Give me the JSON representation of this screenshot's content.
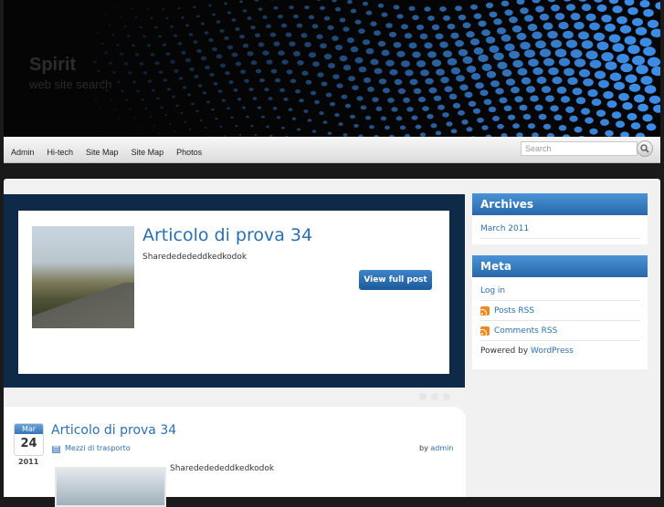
{
  "header": {
    "title": "Spirit",
    "tagline": "web site search"
  },
  "nav": {
    "items": [
      "Admin",
      "Hi-tech",
      "Site Map",
      "Site Map",
      "Photos"
    ],
    "search_placeholder": "Search"
  },
  "featured": {
    "title": "Articolo di prova 34",
    "excerpt": "Sharededededdkedkodok",
    "button": "View full post",
    "slides": 3
  },
  "post": {
    "month": "Mar",
    "day": "24",
    "year": "2011",
    "title": "Articolo di prova 34",
    "category": "Mezzi di trasporto",
    "by_label": "by",
    "author": "admin",
    "excerpt": "Sharededededdkedkodok"
  },
  "sidebar": {
    "archives": {
      "title": "Archives",
      "items": [
        "March 2011"
      ]
    },
    "meta": {
      "title": "Meta",
      "login": "Log in",
      "posts_rss": "Posts RSS",
      "comments_rss": "Comments RSS",
      "powered_prefix": "Powered by",
      "powered_link": "WordPress"
    }
  },
  "colors": {
    "accent": "#2a6fb0",
    "header_bg": "#050505",
    "featured_bg": "#0f2a48"
  }
}
